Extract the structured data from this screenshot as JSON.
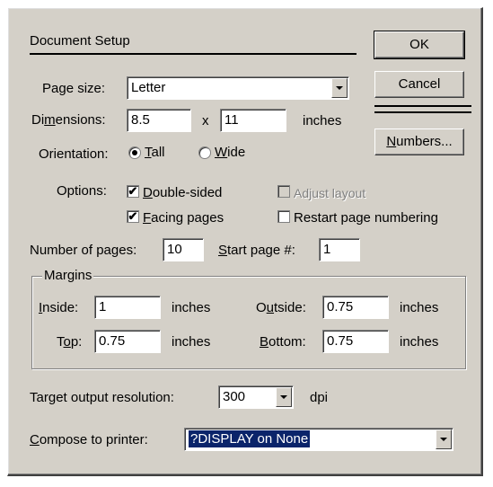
{
  "title": "Document Setup",
  "buttons": {
    "ok": "OK",
    "cancel": "Cancel",
    "numbers": "Numbers..."
  },
  "page_size": {
    "label": "Page size:",
    "value": "Letter"
  },
  "dimensions": {
    "label": "Dimensions:",
    "width": "8.5",
    "x": "x",
    "height": "11",
    "units": "inches"
  },
  "orientation": {
    "label": "Orientation:",
    "tall": "Tall",
    "wide": "Wide",
    "selected": "Tall"
  },
  "options": {
    "label": "Options:",
    "double_sided": {
      "label": "Double-sided",
      "checked": true
    },
    "facing_pages": {
      "label": "Facing pages",
      "checked": true
    },
    "adjust_layout": {
      "label": "Adjust layout",
      "checked": false,
      "disabled": true
    },
    "restart_numbering": {
      "label": "Restart page numbering",
      "checked": false
    }
  },
  "pages": {
    "label": "Number of pages:",
    "value": "10"
  },
  "start_page": {
    "label": "Start page #:",
    "value": "1"
  },
  "margins": {
    "title": "Margins",
    "inside": {
      "label": "Inside:",
      "value": "1"
    },
    "outside": {
      "label": "Outside:",
      "value": "0.75"
    },
    "top": {
      "label": "Top:",
      "value": "0.75"
    },
    "bottom": {
      "label": "Bottom:",
      "value": "0.75"
    },
    "units": "inches"
  },
  "resolution": {
    "label": "Target output resolution:",
    "value": "300",
    "units": "dpi"
  },
  "printer": {
    "label": "Compose to printer:",
    "value": "?DISPLAY on None"
  },
  "check_mark": "✔"
}
